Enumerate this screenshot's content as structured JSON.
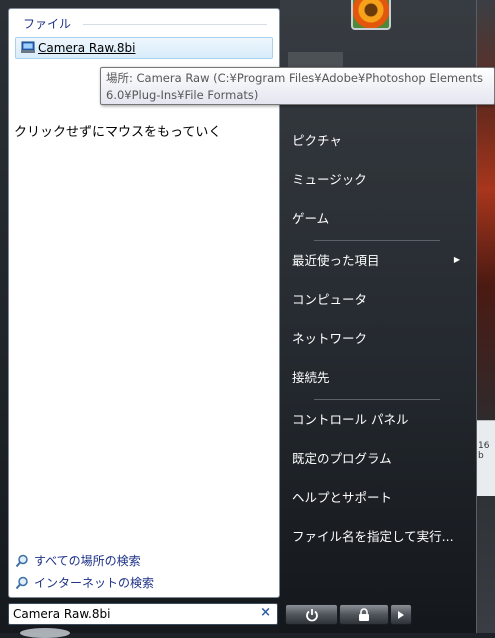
{
  "left_pane": {
    "group_title": "ファイル",
    "file_item_label": "Camera Raw.8bi",
    "note_text": "クリックせずにマウスをもっていく",
    "search_all_label": "すべての場所の検索",
    "search_internet_label": "インターネットの検索"
  },
  "tooltip": {
    "line1": "場所: Camera Raw (C:¥Program Files¥Adobe¥Photoshop Elements",
    "line2": "6.0¥Plug-Ins¥File Formats)"
  },
  "right_pane": {
    "pictures": "ピクチャ",
    "music": "ミュージック",
    "games": "ゲーム",
    "recent_items": "最近使った項目",
    "computer": "コンピュータ",
    "network": "ネットワーク",
    "connect_to": "接続先",
    "control_panel": "コントロール パネル",
    "default_programs": "既定のプログラム",
    "help_support": "ヘルプとサポート",
    "run": "ファイル名を指定して実行..."
  },
  "search": {
    "value": "Camera Raw.8bi",
    "clear_symbol": "×"
  },
  "desktop": {
    "partial_text": "16 b"
  },
  "icons": [
    "file-icon",
    "search-icon",
    "power-icon",
    "lock-icon",
    "arrow-right-icon",
    "user-avatar"
  ]
}
